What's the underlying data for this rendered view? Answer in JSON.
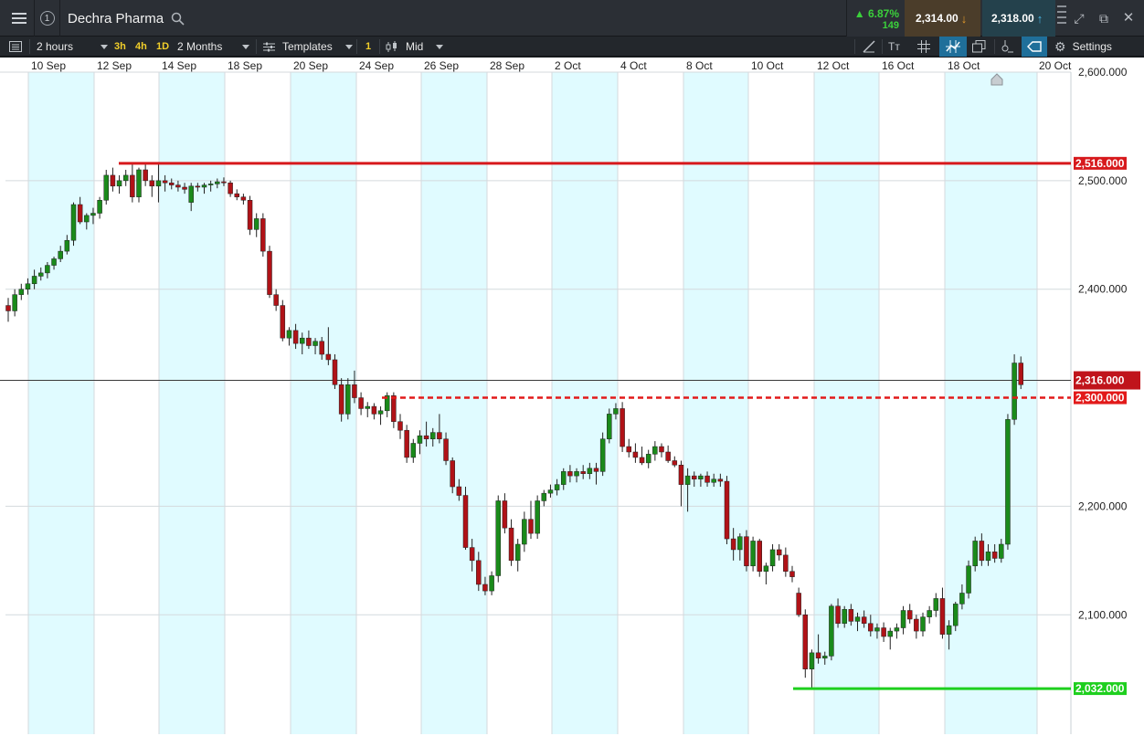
{
  "window": {
    "instrument": "Dechra Pharma",
    "link_number": "1",
    "change_pct": "▲ 6.87%",
    "change_pts": "149",
    "sell_price": "2,314.00",
    "buy_price": "2,318.00",
    "icons": [
      "menu-icon",
      "link-icon",
      "search-icon",
      "grip-icon",
      "expand-icon",
      "popout-icon",
      "close-icon"
    ]
  },
  "toolbar": {
    "interval": "2 hours",
    "quick_intervals": [
      "3h",
      "4h",
      "1D"
    ],
    "range": "2 Months",
    "templates": "Templates",
    "indicator_count": "1",
    "price_type": "Mid",
    "settings": "Settings",
    "icons": [
      "layout-icon",
      "templates-icon",
      "chart-type-icon",
      "draw-line-icon",
      "text-icon",
      "grid-icon",
      "indicators-icon",
      "layers-icon",
      "crosshair-icon",
      "shape-icon",
      "settings-icon"
    ]
  },
  "chart_data": {
    "type": "candlestick",
    "title": "",
    "x_tick_labels": [
      "10 Sep",
      "12 Sep",
      "14 Sep",
      "18 Sep",
      "20 Sep",
      "24 Sep",
      "26 Sep",
      "28 Sep",
      "2 Oct",
      "4 Oct",
      "8 Oct",
      "10 Oct",
      "12 Oct",
      "16 Oct",
      "18 Oct",
      "20 Oct"
    ],
    "y_tick_labels": [
      "2,100.000",
      "2,200.000",
      "2,400.000",
      "2,500.000",
      "2,600.000"
    ],
    "y_ticks": [
      2100,
      2200,
      2400,
      2500,
      2600
    ],
    "ylim": [
      1990,
      2600
    ],
    "price_lines": [
      {
        "label": "2,516.000",
        "value": 2516,
        "style": "solid",
        "color": "#d7191c"
      },
      {
        "label": "2,300.000",
        "value": 2300,
        "style": "dashed",
        "color": "#e21a1a"
      },
      {
        "label": "2,032.000",
        "value": 2032,
        "style": "solid",
        "color": "#1ecf1e"
      }
    ],
    "current_price": {
      "label": "2,316.000",
      "value": 2316,
      "color": "#c0141b"
    },
    "grid": true,
    "day_shading": true,
    "candles": [
      [
        2385,
        2392,
        2370,
        2380
      ],
      [
        2380,
        2400,
        2375,
        2395
      ],
      [
        2395,
        2405,
        2390,
        2400
      ],
      [
        2400,
        2410,
        2395,
        2405
      ],
      [
        2405,
        2418,
        2400,
        2412
      ],
      [
        2412,
        2420,
        2408,
        2415
      ],
      [
        2415,
        2425,
        2410,
        2422
      ],
      [
        2422,
        2430,
        2418,
        2428
      ],
      [
        2428,
        2440,
        2425,
        2435
      ],
      [
        2435,
        2450,
        2432,
        2445
      ],
      [
        2445,
        2480,
        2440,
        2478
      ],
      [
        2478,
        2485,
        2460,
        2462
      ],
      [
        2462,
        2470,
        2455,
        2468
      ],
      [
        2468,
        2475,
        2460,
        2470
      ],
      [
        2470,
        2485,
        2465,
        2482
      ],
      [
        2482,
        2510,
        2478,
        2505
      ],
      [
        2505,
        2512,
        2490,
        2495
      ],
      [
        2495,
        2505,
        2488,
        2500
      ],
      [
        2500,
        2510,
        2495,
        2505
      ],
      [
        2505,
        2515,
        2480,
        2485
      ],
      [
        2485,
        2512,
        2480,
        2510
      ],
      [
        2510,
        2515,
        2495,
        2500
      ],
      [
        2500,
        2505,
        2485,
        2495
      ],
      [
        2495,
        2515,
        2480,
        2500
      ],
      [
        2500,
        2505,
        2490,
        2498
      ],
      [
        2498,
        2502,
        2492,
        2496
      ],
      [
        2496,
        2500,
        2490,
        2494
      ],
      [
        2494,
        2498,
        2488,
        2492
      ],
      [
        2480,
        2498,
        2472,
        2495
      ],
      [
        2495,
        2498,
        2490,
        2494
      ],
      [
        2494,
        2498,
        2488,
        2496
      ],
      [
        2496,
        2500,
        2490,
        2497
      ],
      [
        2497,
        2502,
        2493,
        2499
      ],
      [
        2499,
        2503,
        2495,
        2498
      ],
      [
        2498,
        2500,
        2485,
        2488
      ],
      [
        2488,
        2492,
        2482,
        2485
      ],
      [
        2485,
        2488,
        2478,
        2482
      ],
      [
        2482,
        2486,
        2450,
        2455
      ],
      [
        2455,
        2470,
        2448,
        2465
      ],
      [
        2465,
        2470,
        2430,
        2435
      ],
      [
        2435,
        2440,
        2392,
        2395
      ],
      [
        2395,
        2400,
        2380,
        2385
      ],
      [
        2385,
        2390,
        2352,
        2355
      ],
      [
        2355,
        2365,
        2348,
        2362
      ],
      [
        2362,
        2368,
        2345,
        2350
      ],
      [
        2350,
        2360,
        2340,
        2355
      ],
      [
        2355,
        2362,
        2345,
        2348
      ],
      [
        2348,
        2355,
        2340,
        2352
      ],
      [
        2352,
        2356,
        2335,
        2340
      ],
      [
        2340,
        2365,
        2330,
        2335
      ],
      [
        2335,
        2340,
        2308,
        2312
      ],
      [
        2312,
        2318,
        2278,
        2285
      ],
      [
        2285,
        2318,
        2280,
        2312
      ],
      [
        2312,
        2325,
        2295,
        2300
      ],
      [
        2300,
        2305,
        2284,
        2290
      ],
      [
        2290,
        2296,
        2282,
        2292
      ],
      [
        2292,
        2295,
        2280,
        2285
      ],
      [
        2285,
        2292,
        2275,
        2288
      ],
      [
        2288,
        2305,
        2282,
        2302
      ],
      [
        2302,
        2305,
        2272,
        2278
      ],
      [
        2278,
        2285,
        2262,
        2270
      ],
      [
        2270,
        2275,
        2240,
        2245
      ],
      [
        2245,
        2262,
        2240,
        2258
      ],
      [
        2258,
        2270,
        2248,
        2265
      ],
      [
        2265,
        2278,
        2255,
        2262
      ],
      [
        2262,
        2272,
        2255,
        2268
      ],
      [
        2268,
        2285,
        2258,
        2262
      ],
      [
        2262,
        2268,
        2238,
        2242
      ],
      [
        2242,
        2245,
        2212,
        2218
      ],
      [
        2218,
        2225,
        2205,
        2210
      ],
      [
        2210,
        2218,
        2160,
        2162
      ],
      [
        2162,
        2170,
        2140,
        2150
      ],
      [
        2150,
        2158,
        2122,
        2128
      ],
      [
        2128,
        2135,
        2118,
        2122
      ],
      [
        2122,
        2140,
        2118,
        2136
      ],
      [
        2136,
        2210,
        2130,
        2205
      ],
      [
        2205,
        2212,
        2175,
        2180
      ],
      [
        2180,
        2188,
        2145,
        2150
      ],
      [
        2150,
        2170,
        2140,
        2165
      ],
      [
        2165,
        2195,
        2158,
        2188
      ],
      [
        2188,
        2205,
        2170,
        2175
      ],
      [
        2175,
        2210,
        2170,
        2205
      ],
      [
        2205,
        2215,
        2200,
        2212
      ],
      [
        2212,
        2220,
        2208,
        2215
      ],
      [
        2215,
        2225,
        2210,
        2220
      ],
      [
        2220,
        2235,
        2215,
        2232
      ],
      [
        2232,
        2238,
        2222,
        2228
      ],
      [
        2228,
        2235,
        2222,
        2232
      ],
      [
        2232,
        2238,
        2225,
        2230
      ],
      [
        2230,
        2240,
        2225,
        2235
      ],
      [
        2235,
        2240,
        2220,
        2232
      ],
      [
        2232,
        2268,
        2228,
        2262
      ],
      [
        2262,
        2290,
        2258,
        2285
      ],
      [
        2285,
        2295,
        2280,
        2290
      ],
      [
        2290,
        2296,
        2250,
        2255
      ],
      [
        2255,
        2262,
        2245,
        2250
      ],
      [
        2250,
        2258,
        2240,
        2245
      ],
      [
        2245,
        2255,
        2238,
        2240
      ],
      [
        2240,
        2252,
        2235,
        2248
      ],
      [
        2248,
        2260,
        2242,
        2255
      ],
      [
        2255,
        2258,
        2245,
        2250
      ],
      [
        2250,
        2256,
        2240,
        2242
      ],
      [
        2242,
        2246,
        2236,
        2238
      ],
      [
        2238,
        2242,
        2200,
        2220
      ],
      [
        2220,
        2235,
        2195,
        2228
      ],
      [
        2228,
        2232,
        2218,
        2225
      ],
      [
        2225,
        2230,
        2218,
        2228
      ],
      [
        2228,
        2232,
        2218,
        2222
      ],
      [
        2222,
        2230,
        2218,
        2225
      ],
      [
        2225,
        2230,
        2218,
        2223
      ],
      [
        2223,
        2228,
        2165,
        2170
      ],
      [
        2170,
        2180,
        2150,
        2160
      ],
      [
        2160,
        2175,
        2150,
        2172
      ],
      [
        2172,
        2178,
        2140,
        2145
      ],
      [
        2145,
        2172,
        2140,
        2168
      ],
      [
        2168,
        2170,
        2135,
        2140
      ],
      [
        2140,
        2148,
        2128,
        2145
      ],
      [
        2145,
        2165,
        2140,
        2160
      ],
      [
        2160,
        2165,
        2150,
        2155
      ],
      [
        2155,
        2162,
        2135,
        2140
      ],
      [
        2140,
        2145,
        2130,
        2135
      ],
      [
        2120,
        2125,
        2098,
        2100
      ],
      [
        2100,
        2105,
        2042,
        2050
      ],
      [
        2050,
        2068,
        2032,
        2065
      ],
      [
        2065,
        2082,
        2055,
        2060
      ],
      [
        2060,
        2066,
        2054,
        2062
      ],
      [
        2062,
        2110,
        2058,
        2108
      ],
      [
        2108,
        2115,
        2088,
        2092
      ],
      [
        2092,
        2108,
        2088,
        2105
      ],
      [
        2105,
        2110,
        2090,
        2094
      ],
      [
        2094,
        2102,
        2085,
        2098
      ],
      [
        2098,
        2104,
        2088,
        2092
      ],
      [
        2092,
        2100,
        2080,
        2085
      ],
      [
        2085,
        2092,
        2078,
        2088
      ],
      [
        2088,
        2093,
        2075,
        2080
      ],
      [
        2080,
        2088,
        2068,
        2085
      ],
      [
        2085,
        2092,
        2078,
        2088
      ],
      [
        2088,
        2108,
        2082,
        2104
      ],
      [
        2104,
        2110,
        2092,
        2096
      ],
      [
        2096,
        2100,
        2078,
        2085
      ],
      [
        2085,
        2102,
        2080,
        2098
      ],
      [
        2098,
        2108,
        2092,
        2104
      ],
      [
        2104,
        2120,
        2098,
        2115
      ],
      [
        2115,
        2125,
        2078,
        2082
      ],
      [
        2082,
        2095,
        2068,
        2090
      ],
      [
        2090,
        2112,
        2085,
        2110
      ],
      [
        2110,
        2128,
        2105,
        2120
      ],
      [
        2120,
        2150,
        2115,
        2145
      ],
      [
        2145,
        2172,
        2140,
        2168
      ],
      [
        2168,
        2175,
        2145,
        2150
      ],
      [
        2150,
        2165,
        2145,
        2158
      ],
      [
        2158,
        2165,
        2148,
        2152
      ],
      [
        2152,
        2170,
        2148,
        2165
      ],
      [
        2165,
        2285,
        2160,
        2280
      ],
      [
        2280,
        2340,
        2275,
        2332
      ],
      [
        2332,
        2338,
        2308,
        2312
      ]
    ]
  }
}
